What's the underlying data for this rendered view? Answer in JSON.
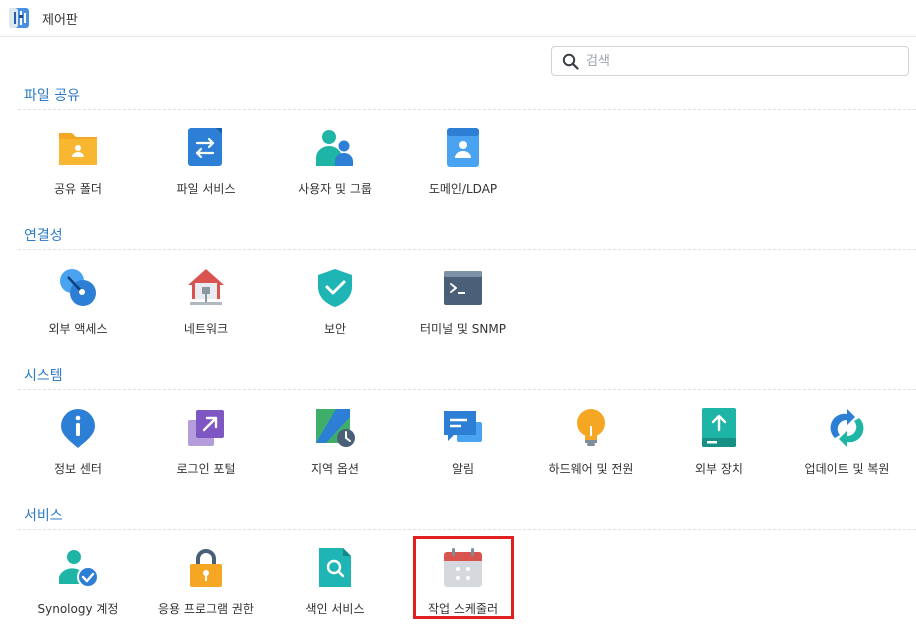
{
  "window": {
    "title": "제어판"
  },
  "search": {
    "placeholder": "검색"
  },
  "sections": [
    {
      "title": "파일 공유",
      "items": [
        {
          "label": "공유 폴더",
          "icon": "shared-folder-icon"
        },
        {
          "label": "파일 서비스",
          "icon": "file-services-icon"
        },
        {
          "label": "사용자 및 그룹",
          "icon": "user-group-icon"
        },
        {
          "label": "도메인/LDAP",
          "icon": "domain-ldap-icon"
        }
      ]
    },
    {
      "title": "연결성",
      "items": [
        {
          "label": "외부 액세스",
          "icon": "external-access-icon"
        },
        {
          "label": "네트워크",
          "icon": "network-icon"
        },
        {
          "label": "보안",
          "icon": "security-shield-icon"
        },
        {
          "label": "터미널 및 SNMP",
          "icon": "terminal-icon"
        }
      ]
    },
    {
      "title": "시스템",
      "items": [
        {
          "label": "정보 센터",
          "icon": "info-center-icon"
        },
        {
          "label": "로그인 포털",
          "icon": "login-portal-icon"
        },
        {
          "label": "지역 옵션",
          "icon": "regional-options-icon"
        },
        {
          "label": "알림",
          "icon": "notification-icon"
        },
        {
          "label": "하드웨어 및 전원",
          "icon": "hardware-power-icon"
        },
        {
          "label": "외부 장치",
          "icon": "external-devices-icon"
        },
        {
          "label": "업데이트 및 복원",
          "icon": "update-restore-icon"
        }
      ]
    },
    {
      "title": "서비스",
      "items": [
        {
          "label": "Synology 계정",
          "icon": "synology-account-icon"
        },
        {
          "label": "응용 프로그램 권한",
          "icon": "application-privileges-icon"
        },
        {
          "label": "색인 서비스",
          "icon": "indexing-service-icon"
        },
        {
          "label": "작업 스케줄러",
          "icon": "task-scheduler-icon"
        }
      ]
    }
  ],
  "colors": {
    "section_title": "#2c7ac9",
    "highlight_border": "#e0201e"
  }
}
